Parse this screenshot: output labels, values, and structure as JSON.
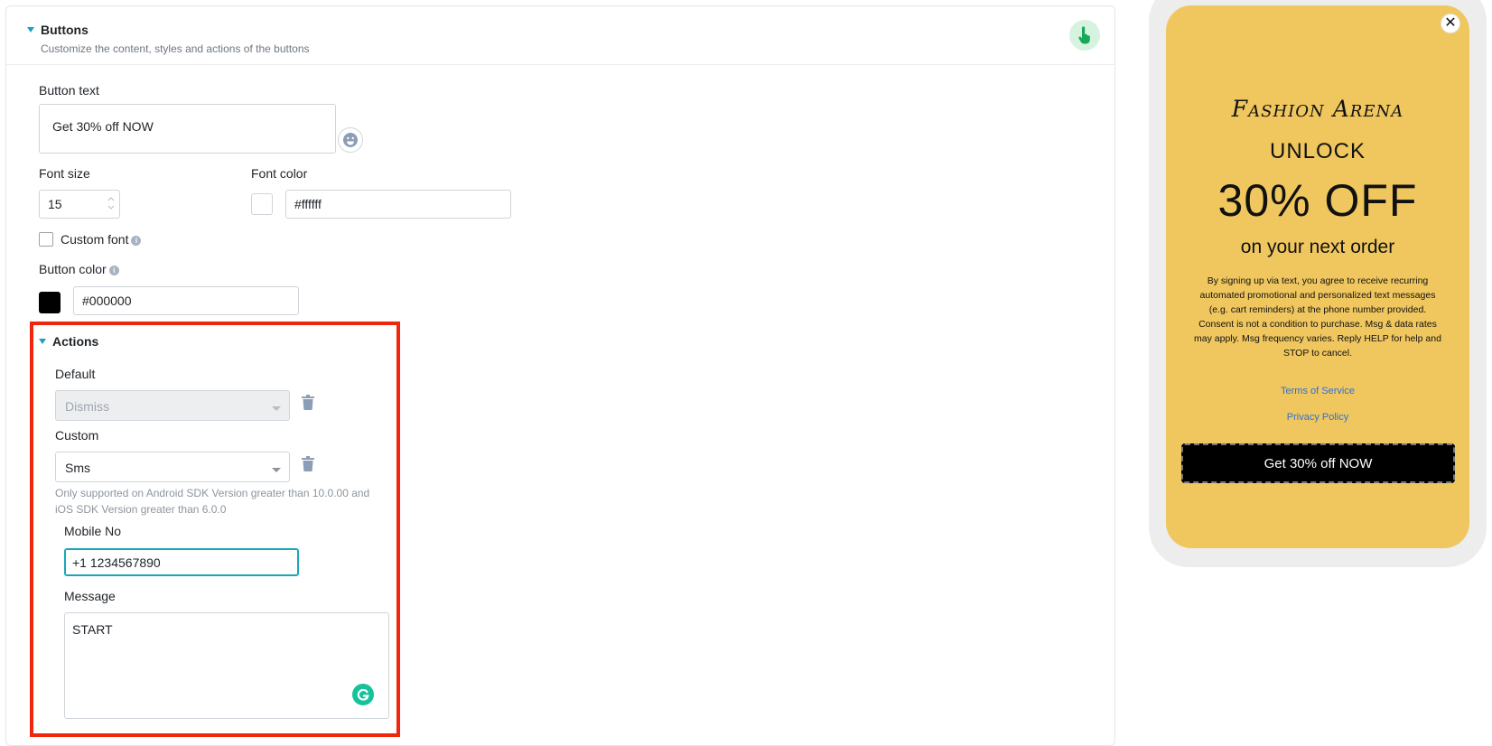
{
  "section": {
    "title": "Buttons",
    "subtitle": "Customize the content, styles and actions of the buttons"
  },
  "button_text": {
    "label": "Button text",
    "value": "Get 30% off NOW"
  },
  "font_size": {
    "label": "Font size",
    "value": "15"
  },
  "font_color": {
    "label": "Font color",
    "value": "#ffffff",
    "swatch": "#ffffff"
  },
  "custom_font": {
    "label": "Custom font",
    "checked": false
  },
  "button_color": {
    "label": "Button color",
    "value": "#000000",
    "swatch": "#000000"
  },
  "actions": {
    "title": "Actions",
    "default_label": "Default",
    "default_value": "Dismiss",
    "custom_label": "Custom",
    "custom_value": "Sms",
    "helper": "Only supported on Android SDK Version greater than 10.0.00 and iOS SDK Version greater than 6.0.0",
    "mobile_label": "Mobile No",
    "mobile_value": "+1 1234567890",
    "message_label": "Message",
    "message_value": "START"
  },
  "preview": {
    "brand": "Fashion Arena",
    "unlock": "UNLOCK",
    "headline": "30% OFF",
    "subheadline": "on your next order",
    "legal": "By signing up via text, you agree to receive recurring automated promotional and personalized text messages (e.g. cart reminders) at the phone number provided. Consent is not a condition to purchase. Msg & data rates may apply. Msg frequency varies. Reply HELP for help and STOP to cancel.",
    "terms_link": "Terms of Service",
    "privacy_link": "Privacy Policy",
    "cta": "Get 30% off NOW",
    "close_glyph": "✕",
    "background": "#f0c75e"
  },
  "icons": [
    "caret-down-icon",
    "hand-pointer-icon",
    "emoji-icon",
    "info-icon",
    "trash-icon",
    "grammarly-icon",
    "close-icon"
  ]
}
